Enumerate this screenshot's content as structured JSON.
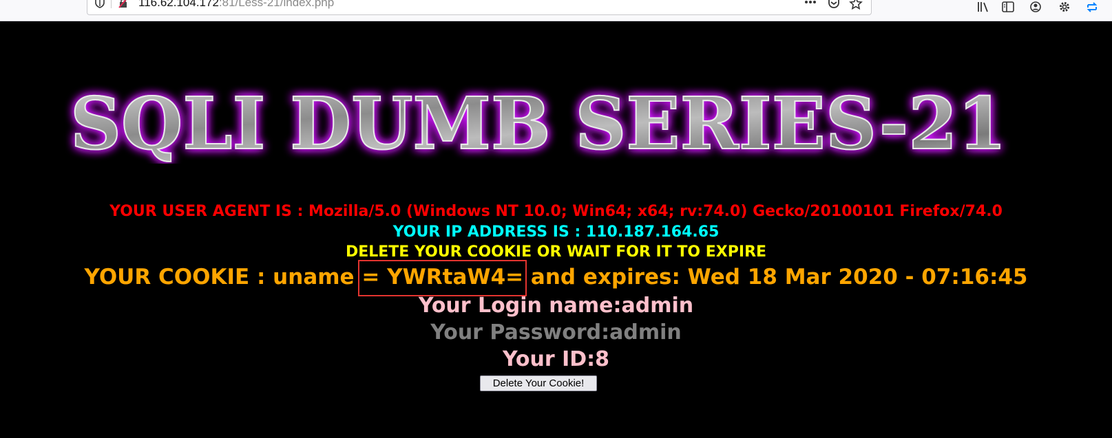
{
  "browser": {
    "url_host": "116.62.104.172",
    "url_rest": ":81/Less-21/index.php"
  },
  "banner": {
    "title": "SQLI DUMB SERIES-21"
  },
  "content": {
    "user_agent_line": "YOUR USER AGENT IS : Mozilla/5.0 (Windows NT 10.0; Win64; x64; rv:74.0) Gecko/20100101 Firefox/74.0",
    "ip_line": "YOUR IP ADDRESS IS : 110.187.164.65",
    "delete_notice": "DELETE YOUR COOKIE OR WAIT FOR IT TO EXPIRE",
    "cookie_line": "YOUR COOKIE : uname = YWRtaW4= and expires: Wed 18 Mar 2020 - 07:16:45",
    "login_line": "Your Login name:admin",
    "password_line": "Your Password:admin",
    "id_line": "Your ID:8",
    "delete_button_label": "Delete Your Cookie!"
  },
  "colors": {
    "background": "#000000",
    "user_agent": "#ff0000",
    "ip": "#00ffff",
    "notice": "#ffff00",
    "cookie": "#ffa500",
    "login": "#ffc0cb",
    "password": "#808080",
    "highlight_box": "#e3342f"
  },
  "icons": [
    "shield-icon",
    "insecure-lock-icon",
    "more-actions-icon",
    "pocket-icon",
    "bookmark-star-icon",
    "library-icon",
    "sidebar-icon",
    "account-icon",
    "settings-icon",
    "sync-icon"
  ]
}
